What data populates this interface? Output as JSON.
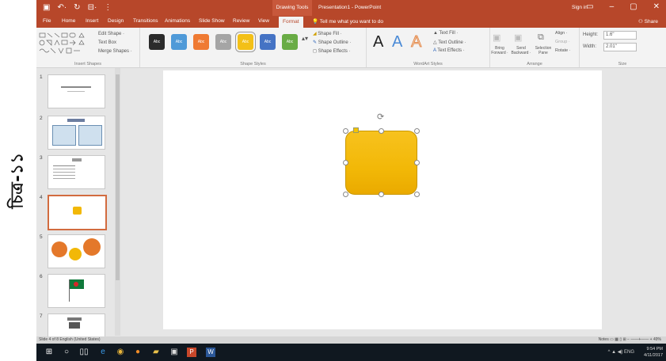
{
  "caption": "চিত্র-১১",
  "window": {
    "quick_access": [
      "▣",
      "↶·",
      "↻",
      "⊟·",
      "⋮"
    ],
    "drawing_tools": "Drawing Tools",
    "doc_title": "Presentation1 - PowerPoint",
    "user": "Sign in",
    "win_buttons": [
      "▭",
      "–",
      "▢",
      "✕"
    ]
  },
  "tabs": {
    "items": [
      "File",
      "Home",
      "Insert",
      "Design",
      "Transitions",
      "Animations",
      "Slide Show",
      "Review",
      "View",
      "Format"
    ],
    "active": "Format",
    "tell_me": "Tell me what you want to do",
    "share": "Share"
  },
  "ribbon": {
    "insert_shapes": {
      "edit_shape": "Edit Shape ·",
      "text_box": "Text Box",
      "merge_shapes": "Merge Shapes ·",
      "label": "Insert Shapes"
    },
    "shape_styles": {
      "swatch_text": "Abc",
      "swatch_colors": [
        "#2b2b2b",
        "#4f9ad8",
        "#ef7a32",
        "#a5a5a5",
        "#f3c017",
        "#4573c4",
        "#69ac45"
      ],
      "selected_index": 4,
      "shape_fill": "Shape Fill ·",
      "shape_outline": "Shape Outline ·",
      "shape_effects": "Shape Effects ·",
      "label": "Shape Styles"
    },
    "wordart": {
      "letters": [
        "A",
        "A",
        "A"
      ],
      "text_fill": "Text Fill ·",
      "text_outline": "Text Outline ·",
      "text_effects": "Text Effects ·",
      "label": "WordArt Styles"
    },
    "arrange": {
      "bring_forward": "Bring Forward ·",
      "send_backward": "Send Backward ·",
      "selection_pane": "Selection Pane",
      "align": "Align ·",
      "group": "Group ·",
      "rotate": "Rotate ·",
      "label": "Arrange"
    },
    "size": {
      "height_label": "Height:",
      "height_value": "1.6\"",
      "width_label": "Width:",
      "width_value": "2.01\"",
      "label": "Size"
    }
  },
  "thumbnails": {
    "numbers": [
      "1",
      "2",
      "3",
      "4",
      "5",
      "6",
      "7"
    ],
    "selected_index": 3
  },
  "status": {
    "left": "Slide 4 of 8   English (United States)",
    "right": "Notes   ▭  ▦  ▯  ⊞   −  ——+——  +   49%"
  },
  "taskbar": {
    "tray": "^  ▲  ◀)  ENG",
    "time": "9:54 PM",
    "date": "4/11/2017"
  }
}
